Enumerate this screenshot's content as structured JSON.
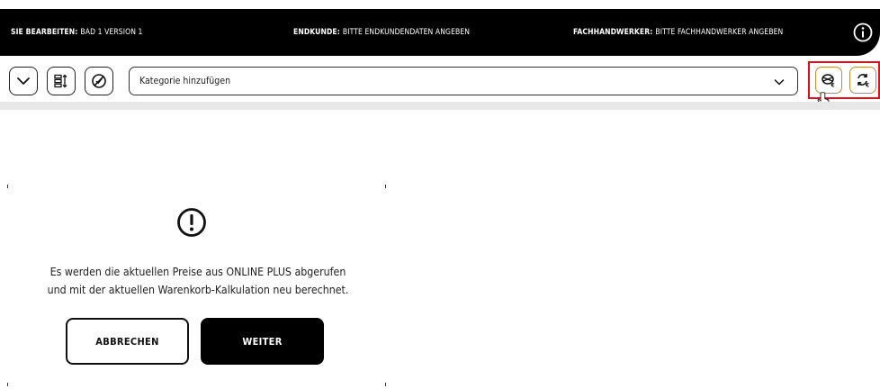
{
  "status_bar": {
    "edit_label": "SIE BEARBEITEN:",
    "edit_value": "BAD 1 VERSION 1",
    "customer_label": "ENDKUNDE:",
    "customer_value": "BITTE ENDKUNDENDATEN ANGEBEN",
    "craftsman_label": "FACHHANDWERKER:",
    "craftsman_value": "BITTE FACHHANDWERKER ANGEBEN",
    "info_icon": "info-icon"
  },
  "toolbar": {
    "collapse_icon": "chevron-down-icon",
    "sort_icon": "sort-list-icon",
    "check_icon": "check-circle-icon",
    "category_select": {
      "placeholder": "Kategorie hinzufügen",
      "dropdown_icon": "chevron-down-icon"
    },
    "price_refresh_icon": "price-refresh-icon",
    "recalculate_icon": "recalculate-icon",
    "highlight_color": "#e3101c",
    "accent_border_color": "#c98a2c"
  },
  "dialog": {
    "icon": "alert-circle-icon",
    "message_line1": "Es werden die aktuellen Preise aus ONLINE PLUS abgerufen",
    "message_line2": "und mit der aktuellen Warenkorb-Kalkulation neu berechnet.",
    "cancel_label": "ABBRECHEN",
    "continue_label": "WEITER"
  }
}
